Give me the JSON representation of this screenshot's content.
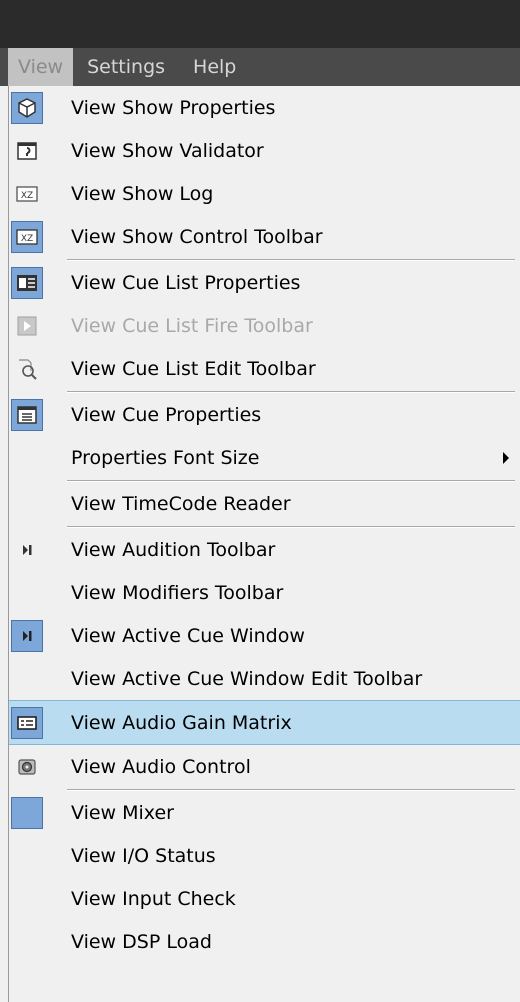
{
  "menubar": {
    "items": [
      "View",
      "Settings",
      "Help"
    ]
  },
  "menu": {
    "items": [
      {
        "label": "View Show Properties",
        "icon": "cube-icon"
      },
      {
        "label": "View Show Validator",
        "icon": "validator-icon"
      },
      {
        "label": "View Show Log",
        "icon": "log-icon"
      },
      {
        "label": "View Show Control Toolbar",
        "icon": "control-toolbar-icon"
      },
      {
        "label": "View Cue List Properties",
        "icon": "cue-list-icon"
      },
      {
        "label": "View Cue List Fire Toolbar",
        "icon": "fire-icon",
        "disabled": true
      },
      {
        "label": "View Cue List Edit Toolbar",
        "icon": "edit-magnifier-icon"
      },
      {
        "label": "View Cue Properties",
        "icon": "cue-properties-icon"
      },
      {
        "label": "Properties Font Size"
      },
      {
        "label": "View TimeCode Reader"
      },
      {
        "label": "View Audition Toolbar",
        "icon": "play-pause-icon"
      },
      {
        "label": "View Modifiers Toolbar"
      },
      {
        "label": "View Active Cue Window",
        "icon": "active-cue-icon"
      },
      {
        "label": "View Active Cue Window Edit Toolbar"
      },
      {
        "label": "View Audio Gain Matrix",
        "icon": "gain-matrix-icon"
      },
      {
        "label": "View Audio Control",
        "icon": "audio-control-icon"
      },
      {
        "label": "View Mixer",
        "icon": "mixer-icon"
      },
      {
        "label": "View I/O Status"
      },
      {
        "label": "View Input Check"
      },
      {
        "label": "View DSP Load"
      }
    ]
  },
  "colors": {
    "highlight": "#b9dcf0",
    "checked_icon_bg": "#7da7d8"
  }
}
